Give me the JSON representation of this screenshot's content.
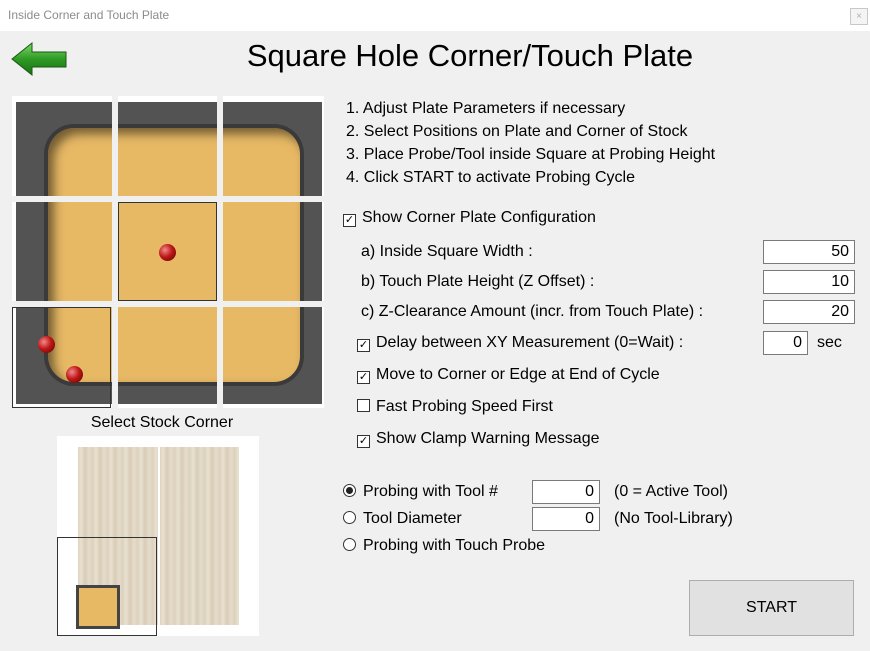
{
  "window": {
    "title": "Inside Corner and Touch Plate",
    "close_label": "×"
  },
  "header": {
    "title": "Square Hole Corner/Touch Plate"
  },
  "steps": [
    "1. Adjust Plate Parameters if necessary",
    "2. Select Positions on Plate and Corner of Stock",
    "3. Place Probe/Tool inside Square at Probing Height",
    "4. Click START to activate Probing Cycle"
  ],
  "show_config": {
    "label": "Show Corner Plate Configuration",
    "checked": true,
    "mark": "✓"
  },
  "params": {
    "a": {
      "label": "a) Inside Square Width :",
      "value": "50"
    },
    "b": {
      "label": "b) Touch Plate Height (Z Offset) :",
      "value": "10"
    },
    "c": {
      "label": "c) Z-Clearance Amount (incr. from Touch Plate) :",
      "value": "20"
    }
  },
  "options": {
    "delay": {
      "label": "Delay between XY Measurement (0=Wait) :",
      "checked": true,
      "mark": "✓",
      "value": "0",
      "unit": "sec"
    },
    "move_corner": {
      "label": "Move to Corner or Edge at End of Cycle",
      "checked": true,
      "mark": "✓"
    },
    "fast_probe": {
      "label": "Fast Probing Speed First",
      "checked": false,
      "mark": ""
    },
    "clamp_warning": {
      "label": "Show Clamp Warning Message",
      "checked": true,
      "mark": "✓"
    }
  },
  "probing": {
    "tool": {
      "label": "Probing with Tool #",
      "value": "0",
      "note": "(0 = Active Tool)",
      "selected": true
    },
    "diameter": {
      "label": "Tool Diameter",
      "value": "0",
      "note": "(No Tool-Library)",
      "selected": false
    },
    "touch_probe": {
      "label": "Probing with Touch Probe",
      "selected": false
    }
  },
  "stock": {
    "label": "Select Stock Corner"
  },
  "buttons": {
    "start": "START"
  },
  "colors": {
    "plate_surface": "#e7b965",
    "plate_frame": "#535353",
    "ball": "#c01818",
    "title_line": "#1c2a6a"
  }
}
